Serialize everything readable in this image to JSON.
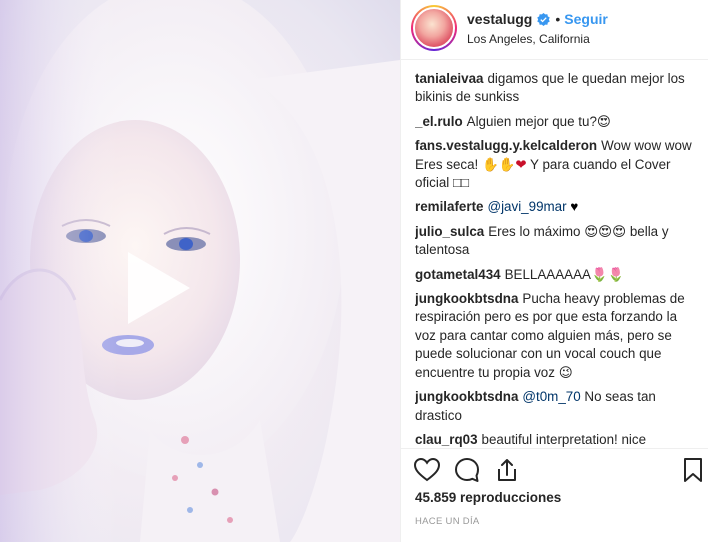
{
  "post": {
    "username": "vestalugg",
    "separator": "•",
    "follow_label": "Seguir",
    "location": "Los Angeles, California"
  },
  "media": {
    "type": "video",
    "play_icon": "play-icon",
    "subject": "portrait-video-thumbnail"
  },
  "comments": [
    {
      "user": "tanialeivaa",
      "text": "digamos que le quedan mejor los bikinis de sunkiss"
    },
    {
      "user": "_el.rulo",
      "text": "Alguien mejor que tu?",
      "emoji": "😍"
    },
    {
      "user": "fans.vestalugg.y.kelcalderon",
      "text": "Wow wow wow Eres seca! ",
      "emoji": "✋✋",
      "emoji2": "❤",
      "text2": " Y para cuando el Cover oficial ",
      "text3": "□□"
    },
    {
      "user": "remilaferte",
      "mention": "@javi_99mar",
      "emoji": "♥"
    },
    {
      "user": "julio_sulca",
      "text": "Eres lo máximo ",
      "emoji": "😍😍😍",
      "text2": " bella y talentosa"
    },
    {
      "user": "gotametal434",
      "text": "BELLAAAAAA",
      "emoji": "🌷🌷"
    },
    {
      "user": "jungkookbtsdna",
      "text": "Pucha heavy problemas de respiración pero es por que esta forzando la voz para cantar como alguien más, pero se puede solucionar con un vocal couch que encuentre tu propia voz",
      "emoji": "😉"
    },
    {
      "user": "jungkookbtsdna",
      "mention": "@t0m_70",
      "text": " No seas tan drastico"
    },
    {
      "user": "clau_rq03",
      "text": "beautiful interpretation! nice"
    }
  ],
  "actions": {
    "like_icon": "heart-icon",
    "comment_icon": "comment-icon",
    "share_icon": "share-icon",
    "save_icon": "bookmark-icon"
  },
  "stats": {
    "views": "45.859 reproducciones",
    "time_ago": "HACE UN DÍA"
  },
  "colors": {
    "link": "#3897f0",
    "mention": "#003569",
    "muted": "#999999",
    "text": "#262626"
  }
}
